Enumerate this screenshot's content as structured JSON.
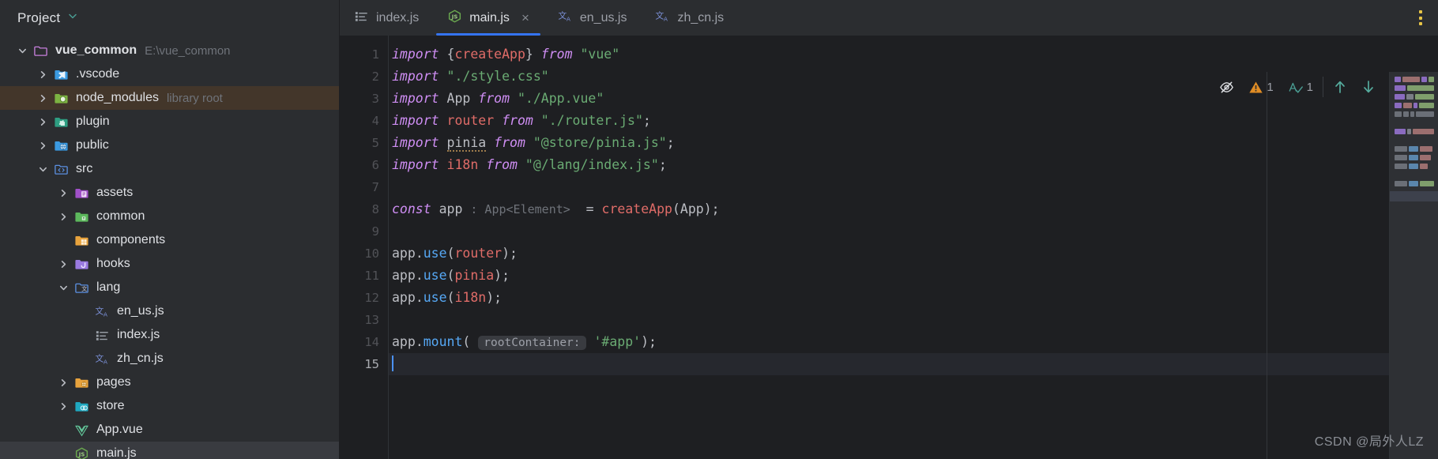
{
  "window": {
    "project_panel_title": "Project",
    "watermark": "CSDN @局外人LZ"
  },
  "tabs": [
    {
      "label": "index.js",
      "icon": "json-list-icon",
      "active": false,
      "closable": false
    },
    {
      "label": "main.js",
      "icon": "js-nodejs-icon",
      "active": true,
      "closable": true,
      "close_label": "×"
    },
    {
      "label": "en_us.js",
      "icon": "i18n-translate-icon",
      "active": false,
      "closable": false
    },
    {
      "label": "zh_cn.js",
      "icon": "i18n-translate-icon",
      "active": false,
      "closable": false
    }
  ],
  "sidebar": {
    "items": [
      {
        "label": "vue_common",
        "sub": "E:\\vue_common",
        "icon": "folder-module-icon",
        "arrow": "expanded",
        "depth": 0,
        "bold": true,
        "state": "none"
      },
      {
        "label": ".vscode",
        "sub": "",
        "icon": "folder-vscode-icon",
        "arrow": "collapsed",
        "depth": 1,
        "bold": false,
        "state": "none"
      },
      {
        "label": "node_modules",
        "sub": "library root",
        "icon": "folder-node-icon",
        "arrow": "collapsed",
        "depth": 1,
        "bold": false,
        "state": "library"
      },
      {
        "label": "plugin",
        "sub": "",
        "icon": "folder-plugin-icon",
        "arrow": "collapsed",
        "depth": 1,
        "bold": false,
        "state": "none"
      },
      {
        "label": "public",
        "sub": "",
        "icon": "folder-web-icon",
        "arrow": "collapsed",
        "depth": 1,
        "bold": false,
        "state": "none"
      },
      {
        "label": "src",
        "sub": "",
        "icon": "folder-source-icon",
        "arrow": "expanded",
        "depth": 1,
        "bold": false,
        "state": "none"
      },
      {
        "label": "assets",
        "sub": "",
        "icon": "folder-assets-icon",
        "arrow": "collapsed",
        "depth": 2,
        "bold": false,
        "state": "none"
      },
      {
        "label": "common",
        "sub": "",
        "icon": "folder-common-icon",
        "arrow": "collapsed",
        "depth": 2,
        "bold": false,
        "state": "none"
      },
      {
        "label": "components",
        "sub": "",
        "icon": "folder-components-icon",
        "arrow": "none",
        "depth": 2,
        "bold": false,
        "state": "none"
      },
      {
        "label": "hooks",
        "sub": "",
        "icon": "folder-hooks-icon",
        "arrow": "collapsed",
        "depth": 2,
        "bold": false,
        "state": "none"
      },
      {
        "label": "lang",
        "sub": "",
        "icon": "folder-lang-icon",
        "arrow": "expanded",
        "depth": 2,
        "bold": false,
        "state": "none"
      },
      {
        "label": "en_us.js",
        "sub": "",
        "icon": "i18n-translate-icon",
        "arrow": "none",
        "depth": 3,
        "bold": false,
        "state": "none"
      },
      {
        "label": "index.js",
        "sub": "",
        "icon": "json-list-icon",
        "arrow": "none",
        "depth": 3,
        "bold": false,
        "state": "none"
      },
      {
        "label": "zh_cn.js",
        "sub": "",
        "icon": "i18n-translate-icon",
        "arrow": "none",
        "depth": 3,
        "bold": false,
        "state": "none"
      },
      {
        "label": "pages",
        "sub": "",
        "icon": "folder-pages-icon",
        "arrow": "collapsed",
        "depth": 2,
        "bold": false,
        "state": "none"
      },
      {
        "label": "store",
        "sub": "",
        "icon": "folder-store-icon",
        "arrow": "collapsed",
        "depth": 2,
        "bold": false,
        "state": "none"
      },
      {
        "label": "App.vue",
        "sub": "",
        "icon": "vue-file-icon",
        "arrow": "none",
        "depth": 2,
        "bold": false,
        "state": "none"
      },
      {
        "label": "main.js",
        "sub": "",
        "icon": "js-nodejs-icon",
        "arrow": "none",
        "depth": 2,
        "bold": false,
        "state": "selected"
      }
    ]
  },
  "editor": {
    "line_numbers": [
      "1",
      "2",
      "3",
      "4",
      "5",
      "6",
      "7",
      "8",
      "9",
      "10",
      "11",
      "12",
      "13",
      "14",
      "15"
    ],
    "current_line": 15,
    "code_plain": [
      "import {createApp} from \"vue\"",
      "import \"./style.css\"",
      "import App from \"./App.vue\"",
      "import router from \"./router.js\";",
      "import pinia from \"@store/pinia.js\";",
      "import i18n from \"@/lang/index.js\";",
      "",
      "const app : App<Element>  = createApp(App);",
      "",
      "app.use(router);",
      "app.use(pinia);",
      "app.use(i18n);",
      "",
      "app.mount( rootContainer: '#app');",
      ""
    ],
    "inlay_hints": {
      "line8_type": ": App<Element>",
      "line14_param": "rootContainer:"
    }
  },
  "inspection_widget": {
    "eye_icon": "eye-slash-icon",
    "warning_icon": "warning-triangle-icon",
    "warning_count": "1",
    "spellcheck_icon": "spellcheck-icon",
    "spellcheck_count": "1",
    "prev_icon": "arrow-up-icon",
    "next_icon": "arrow-down-icon"
  },
  "colors": {
    "bg_panel": "#2b2d30",
    "bg_editor": "#1e1f22",
    "accent_tab": "#3574f0",
    "keyword": "#cf8ef4",
    "string": "#6aab73",
    "function": "#e06c68",
    "method": "#56a8f5",
    "hint": "#6f737a",
    "warning": "#e08c24",
    "spellcheck": "#4a9c92",
    "kebab": "#e8c547",
    "highlight_library": "#43362a",
    "highlight_selected": "#393b40"
  },
  "minimap": {
    "rows": [
      [
        [
          16,
          "#8a6bbf"
        ],
        [
          42,
          "#9c6f6f"
        ],
        [
          12,
          "#8a6bbf"
        ],
        [
          14,
          "#7f9e6c"
        ]
      ],
      [
        [
          16,
          "#8a6bbf"
        ],
        [
          40,
          "#7f9e6c"
        ]
      ],
      [
        [
          16,
          "#8a6bbf"
        ],
        [
          12,
          "#7a7e86"
        ],
        [
          30,
          "#7f9e6c"
        ]
      ],
      [
        [
          16,
          "#8a6bbf"
        ],
        [
          20,
          "#9c6f6f"
        ],
        [
          10,
          "#8a6bbf"
        ],
        [
          34,
          "#7f9e6c"
        ]
      ],
      [
        [
          12,
          "#6b6f77"
        ],
        [
          10,
          "#6b6f77"
        ],
        [
          8,
          "#6b6f77"
        ],
        [
          32,
          "#6b6f77"
        ]
      ],
      [],
      [
        [
          14,
          "#8a6bbf"
        ],
        [
          5,
          "#7a7e86"
        ],
        [
          28,
          "#9c6f6f"
        ]
      ],
      [],
      [
        [
          16,
          "#6b6f77"
        ],
        [
          12,
          "#5a86ad"
        ],
        [
          16,
          "#9c6f6f"
        ]
      ],
      [
        [
          16,
          "#6b6f77"
        ],
        [
          12,
          "#5a86ad"
        ],
        [
          14,
          "#9c6f6f"
        ]
      ],
      [
        [
          16,
          "#6b6f77"
        ],
        [
          12,
          "#5a86ad"
        ],
        [
          10,
          "#9c6f6f"
        ]
      ],
      [],
      [
        [
          16,
          "#6b6f77"
        ],
        [
          12,
          "#5a86ad"
        ],
        [
          18,
          "#7f9e6c"
        ]
      ]
    ]
  }
}
